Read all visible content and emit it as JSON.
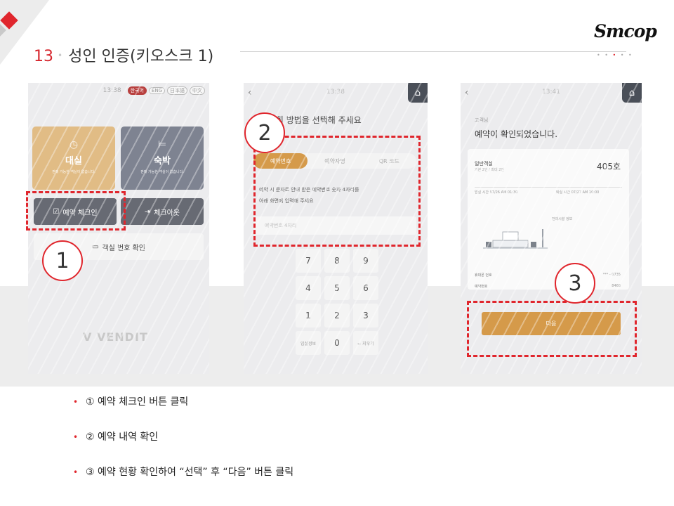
{
  "header": {
    "section_number": "13",
    "separator": "•",
    "title": "성인 인증(키오스크 1)",
    "logo_text": "Smcop",
    "pager": "• • — • •"
  },
  "screen1": {
    "time": "13:38",
    "languages": [
      "한국어",
      "ENG",
      "日本語",
      "中文"
    ],
    "tile_daesil_title": "대실",
    "tile_daesil_sub": "판매 가능한 객실이 없습니다.",
    "tile_sukbak_title": "숙박",
    "tile_sukbak_sub": "판매 가능한 객실이 없습니다.",
    "checkin_label": "예약 체크인",
    "checkout_label": "체크아웃",
    "room_check_label": "객실 번호 확인",
    "watermark": "VENDIT"
  },
  "screen2": {
    "time": "13:38",
    "prompt": "약 조회 방법을 선택해 주세요",
    "tabs": [
      "예약번호",
      "예약자명",
      "QR 코드"
    ],
    "info_line1": "예약 시 문자로 안내 받은 예약번호 숫자 4자리를",
    "info_line2": "아래 화면에 입력해 주세요",
    "input_placeholder": "예약번호 4자리",
    "keys": [
      "7",
      "8",
      "9",
      "4",
      "5",
      "6",
      "1",
      "2",
      "3",
      "입실정보",
      "0",
      "← 지우기"
    ]
  },
  "screen3": {
    "time": "13:41",
    "greeting": "고객님",
    "confirmed": "예약이 확인되었습니다.",
    "room_type": "일반객실",
    "room_sub": "기본 2인 / 최대 2인",
    "room_number": "405호",
    "checkin_time": "입실 시간 07/26 AM 01:30",
    "checkout_time": "퇴실 시간 07/27 AM 10:00",
    "facility": "편의시설 정보",
    "phone_label": "휴대폰 번호",
    "phone_value": "*** - 0735",
    "resv_label": "예약번호",
    "resv_value": "8468",
    "next_label": "다음"
  },
  "annotations": [
    "1",
    "2",
    "3"
  ],
  "bullets": [
    "① 예약 체크인 버튼 클릭",
    "② 예약 내역 확인",
    "③ 예약 현황 확인하여 “선택” 후 “다음” 버튼 클릭"
  ],
  "colors": {
    "accent": "#e0262d",
    "gold": "#d59a4a",
    "slate": "#676a73"
  }
}
